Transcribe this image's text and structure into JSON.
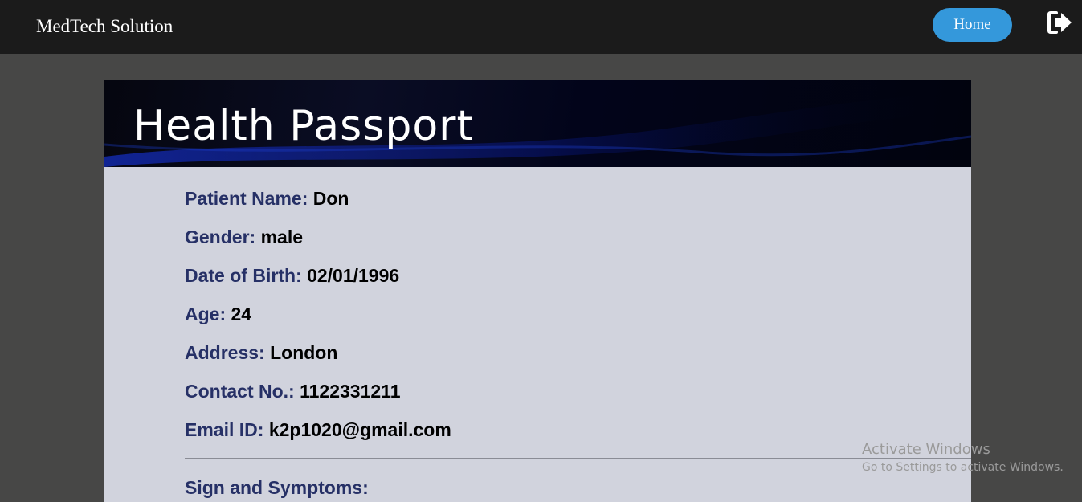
{
  "navbar": {
    "brand": "MedTech Solution",
    "home_label": "Home",
    "logout_icon": "sign-out-icon"
  },
  "card": {
    "banner_title": "Health Passport",
    "fields": [
      {
        "label": "Patient Name: ",
        "value": "Don"
      },
      {
        "label": "Gender: ",
        "value": "male"
      },
      {
        "label": "Date of Birth: ",
        "value": "02/01/1996"
      },
      {
        "label": "Age: ",
        "value": "24"
      },
      {
        "label": "Address: ",
        "value": "London"
      },
      {
        "label": "Contact No.: ",
        "value": "1122331211"
      },
      {
        "label": "Email ID: ",
        "value": "k2p1020@gmail.com"
      }
    ],
    "symptoms_heading": "Sign and Symptoms:"
  },
  "watermark": {
    "line1": "Activate Windows",
    "line2": "Go to Settings to activate Windows."
  },
  "colors": {
    "navbar_bg": "#1b1b1b",
    "page_bg": "#474746",
    "card_bg": "#d1d3dd",
    "label_color": "#263066",
    "home_button": "#3498db"
  }
}
